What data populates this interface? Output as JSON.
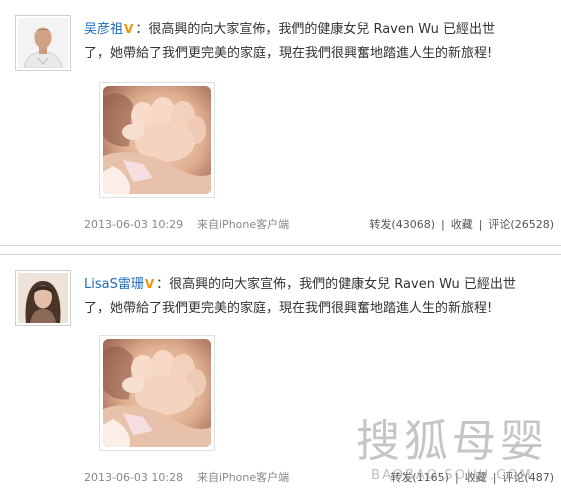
{
  "posts": [
    {
      "author": "吴彦祖",
      "verified_badge": "V",
      "text_line1": "：很高興的向大家宣佈，我們的健康女兒 Raven Wu 已經出世",
      "text_line2": "了，她帶給了我們更完美的家庭，現在我們很興奮地踏進人生的新旅程!",
      "time": "2013-06-03 10:29",
      "source": "来自iPhone客户端",
      "repost": "转发(43068)",
      "favorite": "收藏",
      "comment": "评论(26528)"
    },
    {
      "author": "LisaS雷珊",
      "verified_badge": "V",
      "text_line1": "：很高興的向大家宣佈，我們的健康女兒 Raven Wu 已經出世",
      "text_line2": "了，她帶給了我們更完美的家庭，現在我們很興奮地踏進人生的新旅程!",
      "time": "2013-06-03 10:28",
      "source": "来自iPhone客户端",
      "repost": "转发(1165)",
      "favorite": "收藏",
      "comment": "评论(487)"
    }
  ],
  "watermark": {
    "main": "搜狐母婴",
    "sub": "BAOBAO.SOHU.COM"
  },
  "colors": {
    "nickname": "#1e6bb8",
    "verified_badge": "#f29200",
    "meta": "#888888",
    "divider": "#d6d6d6"
  }
}
